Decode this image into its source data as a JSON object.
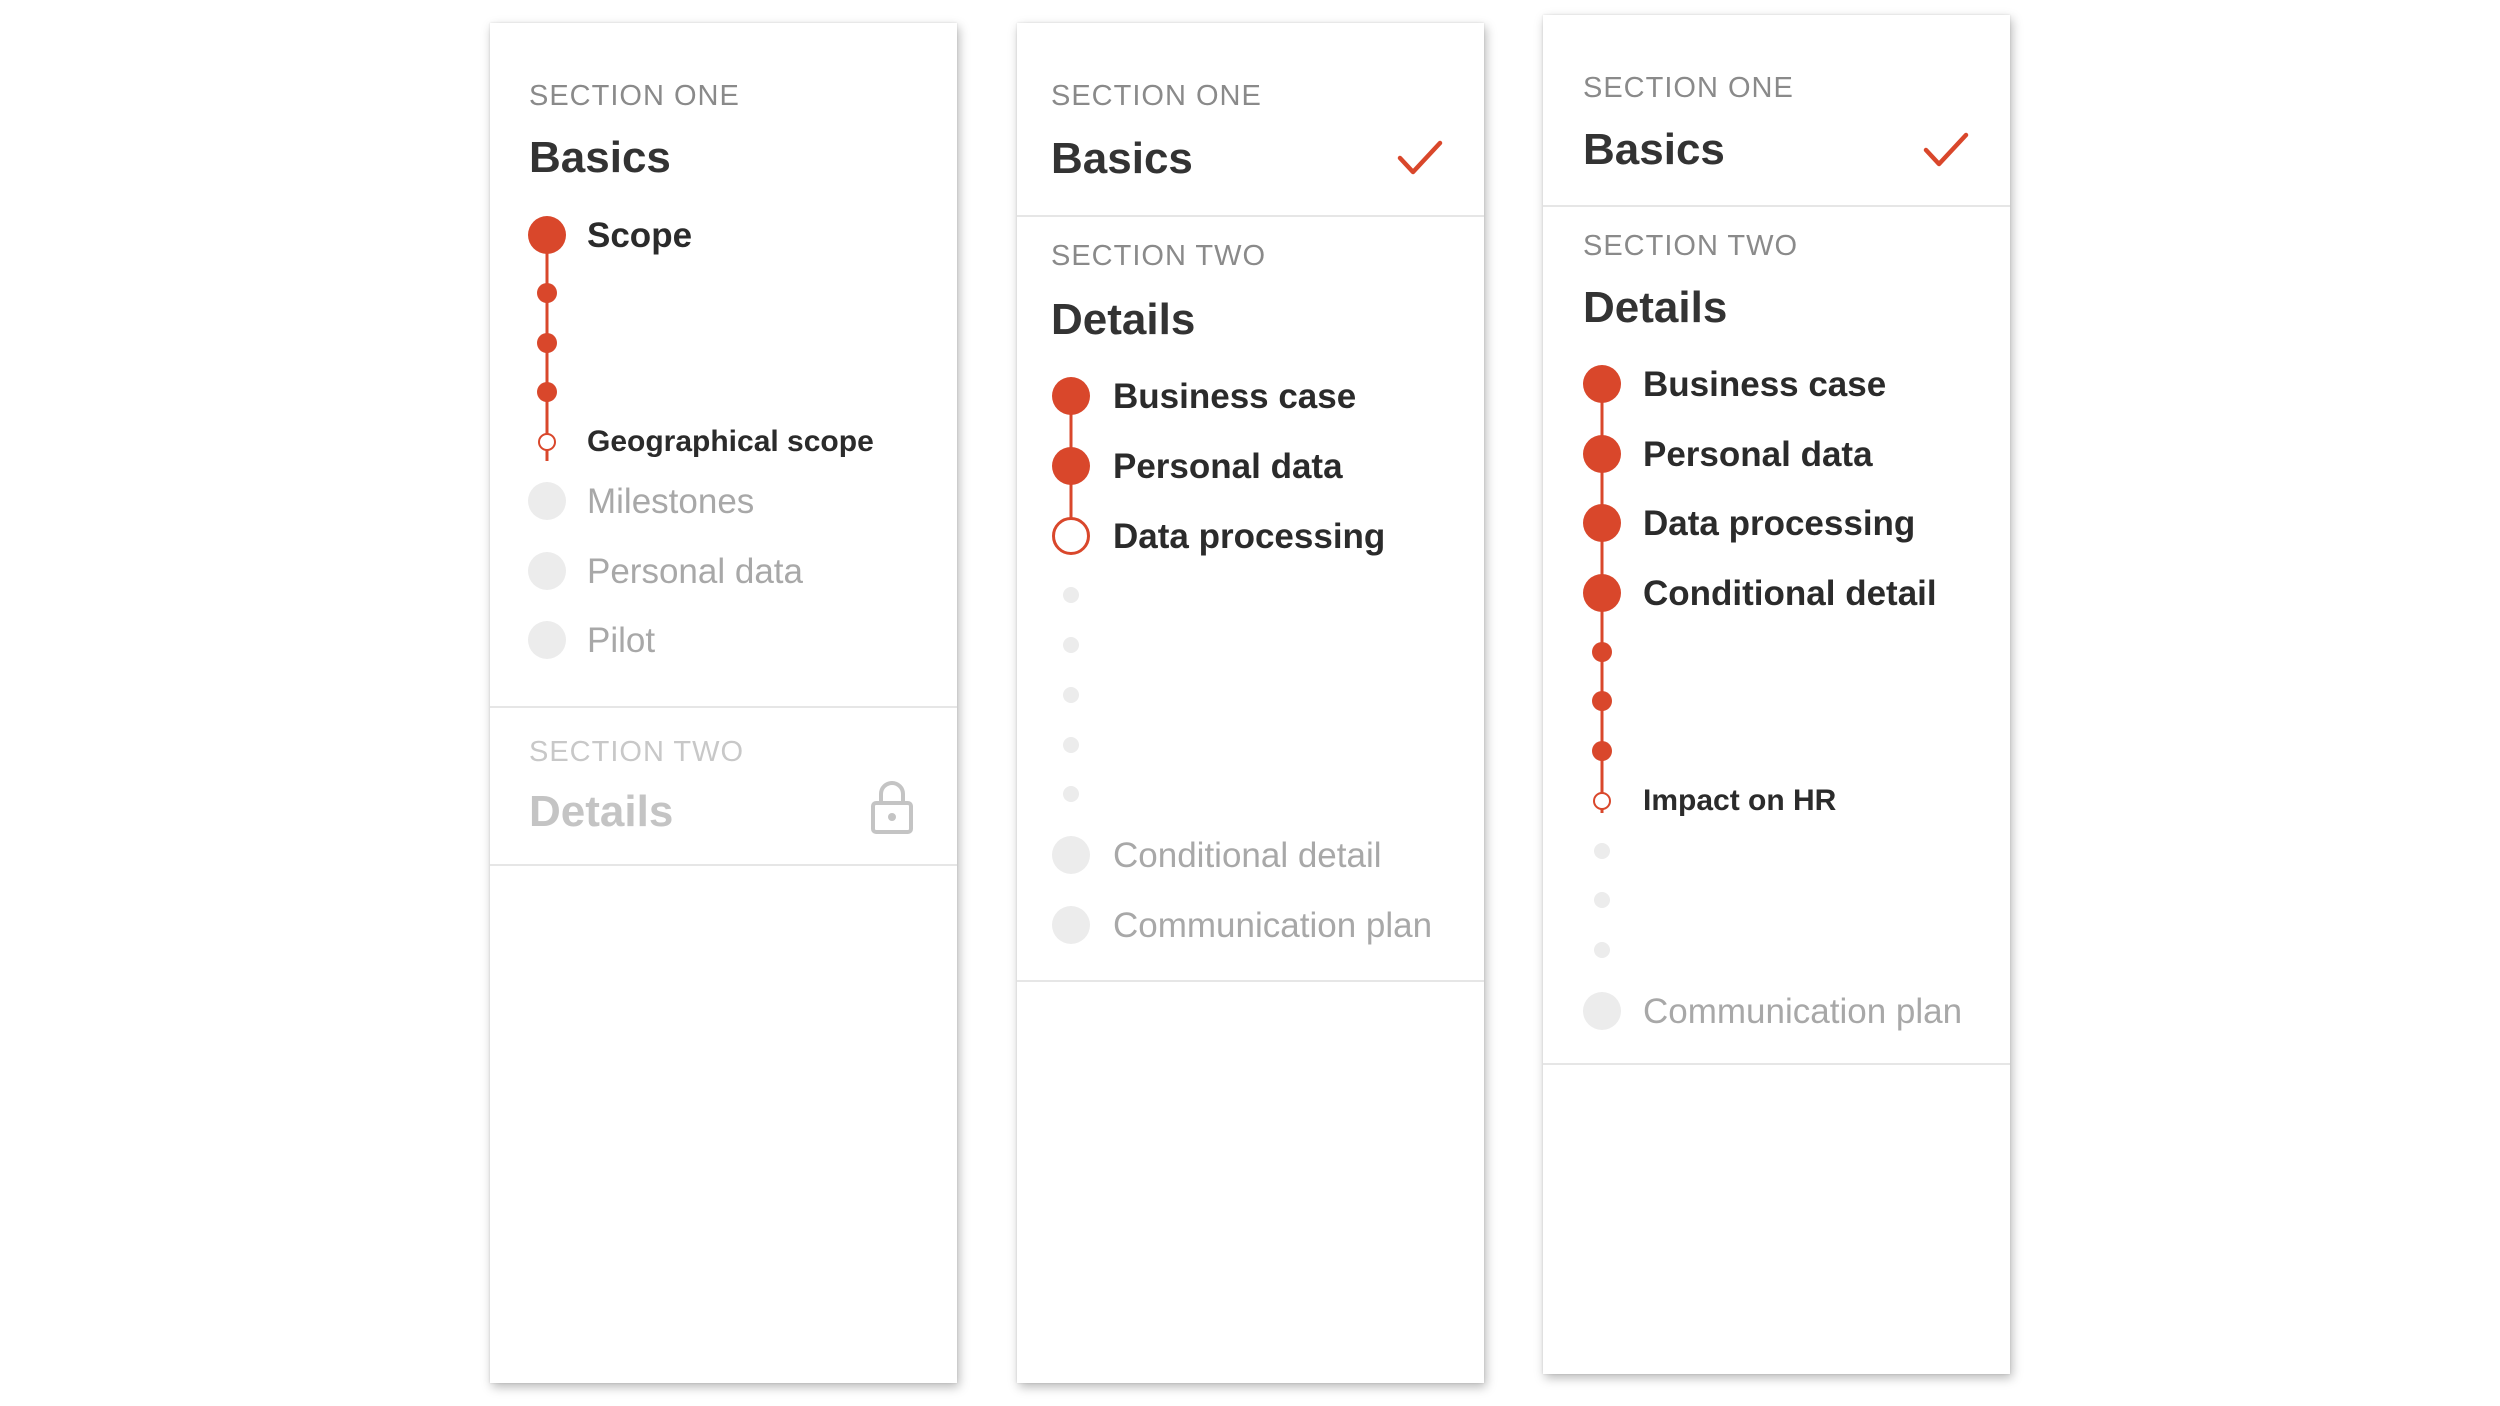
{
  "colors": {
    "accent": "#d9472b",
    "pending": "#ececec",
    "text": "#333333",
    "muted": "#a8a8a8"
  },
  "panels": [
    {
      "sections": [
        {
          "label": "SECTION ONE",
          "title": "Basics",
          "steps": [
            {
              "label": "Scope",
              "status": "complete"
            },
            {
              "label": "Geographical scope",
              "status": "current"
            },
            {
              "label": "Milestones",
              "status": "pending"
            },
            {
              "label": "Personal data",
              "status": "pending"
            },
            {
              "label": "Pilot",
              "status": "pending"
            }
          ]
        },
        {
          "label": "SECTION TWO",
          "title": "Details",
          "icon": "lock-icon",
          "state": "locked"
        }
      ]
    },
    {
      "sections": [
        {
          "label": "SECTION ONE",
          "title": "Basics",
          "icon": "checkmark-icon",
          "state": "complete"
        },
        {
          "label": "SECTION TWO",
          "title": "Details",
          "steps": [
            {
              "label": "Business case",
              "status": "complete"
            },
            {
              "label": "Personal data",
              "status": "complete"
            },
            {
              "label": "Data processing",
              "status": "current"
            },
            {
              "label": "Conditional detail",
              "status": "pending"
            },
            {
              "label": "Communication plan",
              "status": "pending"
            }
          ]
        }
      ]
    },
    {
      "sections": [
        {
          "label": "SECTION ONE",
          "title": "Basics",
          "icon": "checkmark-icon",
          "state": "complete"
        },
        {
          "label": "SECTION TWO",
          "title": "Details",
          "steps": [
            {
              "label": "Business case",
              "status": "complete"
            },
            {
              "label": "Personal data",
              "status": "complete"
            },
            {
              "label": "Data processing",
              "status": "complete"
            },
            {
              "label": "Conditional detail",
              "status": "complete"
            },
            {
              "label": "Impact on HR",
              "status": "current"
            },
            {
              "label": "Communication plan",
              "status": "pending"
            }
          ]
        }
      ]
    }
  ]
}
